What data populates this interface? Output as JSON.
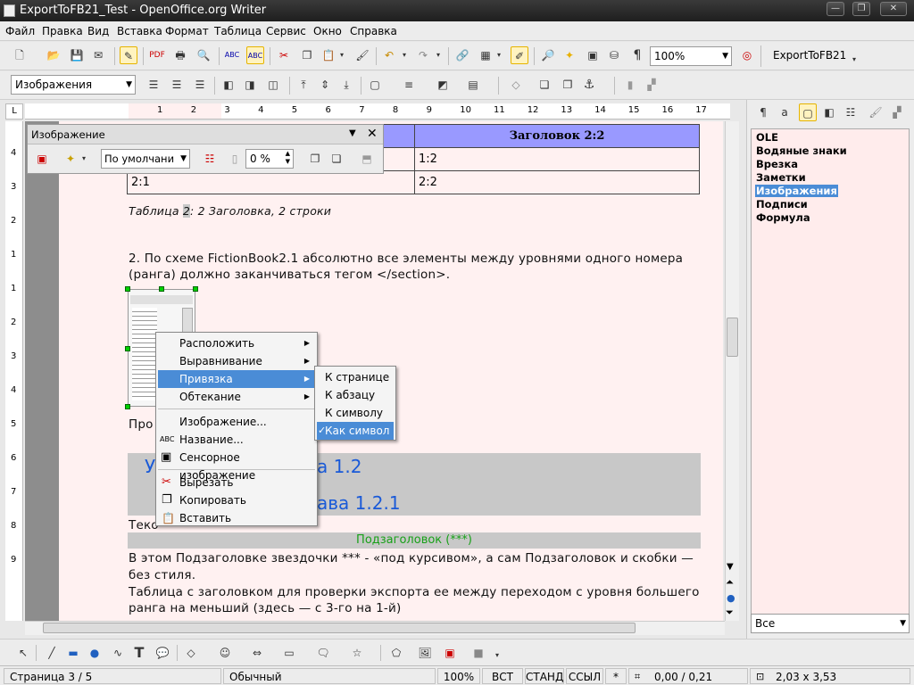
{
  "window": {
    "title": "ExportToFB21_Test - OpenOffice.org Writer"
  },
  "menu": [
    "Файл",
    "Правка",
    "Вид",
    "Вставка",
    "Формат",
    "Таблица",
    "Сервис",
    "Окно",
    "Справка"
  ],
  "toolbar": {
    "zoom_value": "100%",
    "export_button": "ExportToFB21",
    "style_value": "Изображения",
    "pilcrow": "¶"
  },
  "image_toolbar": {
    "title": "Изображение",
    "mode_value": "По умолчани",
    "transparency_value": "0 %"
  },
  "ruler": {
    "h_ticks": [
      "1",
      "2",
      "3",
      "4",
      "5",
      "6",
      "7",
      "8",
      "9",
      "10",
      "11",
      "12",
      "13",
      "14",
      "15",
      "16",
      "17"
    ],
    "v_ticks": [
      "4",
      "3",
      "2",
      "1",
      "1",
      "2",
      "3",
      "4",
      "5",
      "6",
      "7",
      "8",
      "9"
    ]
  },
  "document": {
    "table": {
      "header2": "Заголовок 2:2",
      "r1c2": "1:2",
      "r2c1": "2:1",
      "r2c2": "2:2"
    },
    "caption_prefix": "Таблица ",
    "caption_num": "2",
    "caption_rest": ": 2 Заголовка, 2 строки",
    "para1_line1": "2. По схеме FictionBook2.1 абсолютно все элементы между уровнями одного номера",
    "para1_line2": "(ранга) должно заканчиваться тегом </section>.",
    "frag_pro": "Про",
    "frag_teko": "Теко",
    "heading_u": "У",
    "heading1_tail": "а 1.2",
    "heading2_tail": "ава 1.2.1",
    "subheading": "Подзаголовок (***)",
    "para2_line1": "В этом Подзаголовке звездочки *** - «под курсивом», а сам Подзаголовок и скобки —",
    "para2_line2": "без стиля.",
    "para3_line1": "Таблица с заголовком для проверки экспорта ее между  переходом с уровня большего",
    "para3_line2": "ранга на меньший (здесь — с 3-го на 1-й)"
  },
  "context_menu": {
    "items": [
      "Расположить",
      "Выравнивание",
      "Привязка",
      "Обтекание",
      "Изображение...",
      "Название...",
      "Сенсорное изображение",
      "Вырезать",
      "Копировать",
      "Вставить"
    ]
  },
  "submenu": {
    "items": [
      "К странице",
      "К абзацу",
      "К символу",
      "Как символ"
    ]
  },
  "navigator": {
    "items": [
      "OLE",
      "Водяные знаки",
      "Врезка",
      "Заметки",
      "Изображения",
      "Подписи",
      "Формула"
    ],
    "selected": "Изображения",
    "bottom_select": "Все"
  },
  "statusbar": {
    "page": "Страница  3 / 5",
    "style": "Обычный",
    "zoom": "100%",
    "insert": "ВСТ",
    "select_mode": "СТАНД",
    "hyperlink": "ССЫЛ",
    "modified": "*",
    "position": "0,00 / 0,21",
    "size": "2,03 x 3,53"
  },
  "colors": {
    "accent": "#4a8cd6",
    "table_header": "#9999ff",
    "page_bg": "#fff1f1",
    "heading_blue": "#1a5ad8",
    "sub_green": "#18a018"
  }
}
